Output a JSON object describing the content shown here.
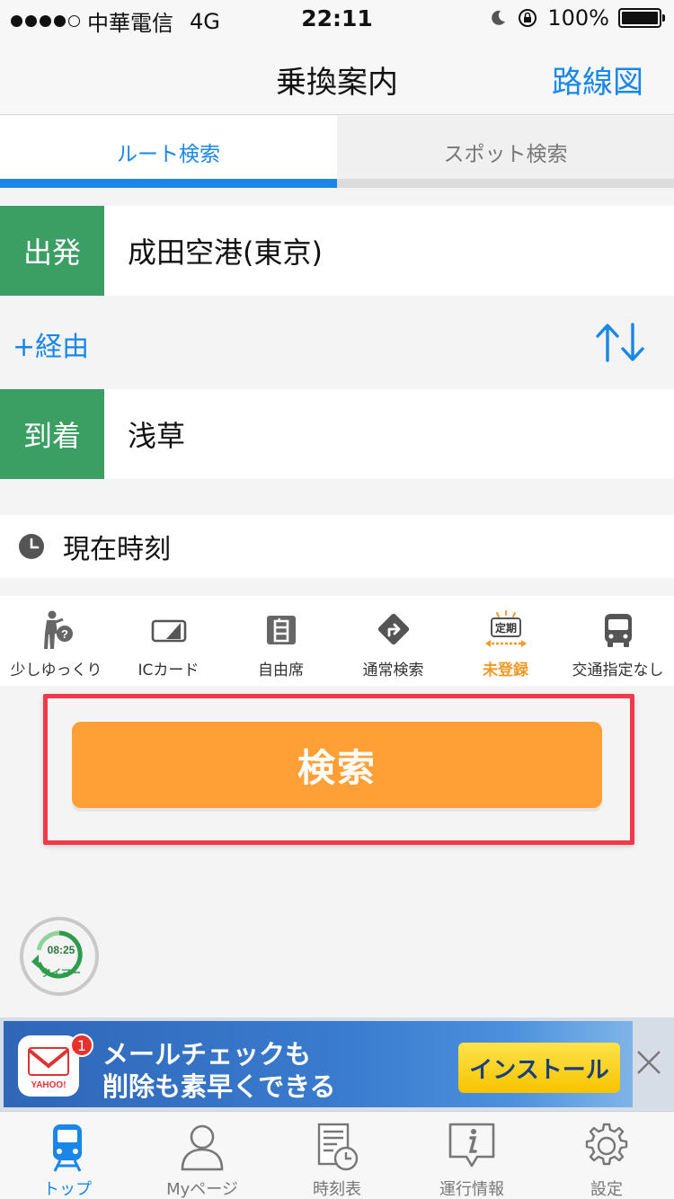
{
  "status_bar": {
    "carrier": "中華電信",
    "network": "4G",
    "time": "22:11",
    "battery_percent": "100%",
    "signal_bars_filled": 4
  },
  "nav": {
    "title": "乗換案内",
    "right_button": "路線図"
  },
  "tabs": [
    {
      "label": "ルート検索",
      "active": true
    },
    {
      "label": "スポット検索",
      "active": false
    }
  ],
  "departure": {
    "label": "出発",
    "value": "成田空港(東京)"
  },
  "via": {
    "label": "+経由"
  },
  "arrival": {
    "label": "到着",
    "value": "浅草"
  },
  "time_setting": {
    "label": "現在時刻"
  },
  "options": [
    {
      "label": "少しゆっくり",
      "icon": "walking-speed-icon"
    },
    {
      "label": "ICカード",
      "icon": "ic-card-icon"
    },
    {
      "label": "自由席",
      "icon": "free-seat-icon"
    },
    {
      "label": "通常検索",
      "icon": "route-direction-icon"
    },
    {
      "label": "未登録",
      "icon": "commuter-pass-icon",
      "badge": "定期"
    },
    {
      "label": "交通指定なし",
      "icon": "bus-icon"
    }
  ],
  "search_button": "検索",
  "timer": {
    "time": "08:25",
    "label": "タイマー"
  },
  "ad": {
    "line1": "メールチェックも",
    "line2": "削除も素早くできる",
    "cta": "インストール",
    "badge_count": "1",
    "app_logo": "YAHOO!"
  },
  "tabbar": [
    {
      "label": "トップ",
      "active": true
    },
    {
      "label": "Myページ",
      "active": false
    },
    {
      "label": "時刻表",
      "active": false
    },
    {
      "label": "運行情報",
      "active": false
    },
    {
      "label": "設定",
      "active": false
    }
  ],
  "colors": {
    "accent": "#1a86e8",
    "station_label": "#3b9e63",
    "search_button": "#ffa037",
    "highlight_border": "#ef3a4a",
    "option_active": "#f09a27"
  }
}
